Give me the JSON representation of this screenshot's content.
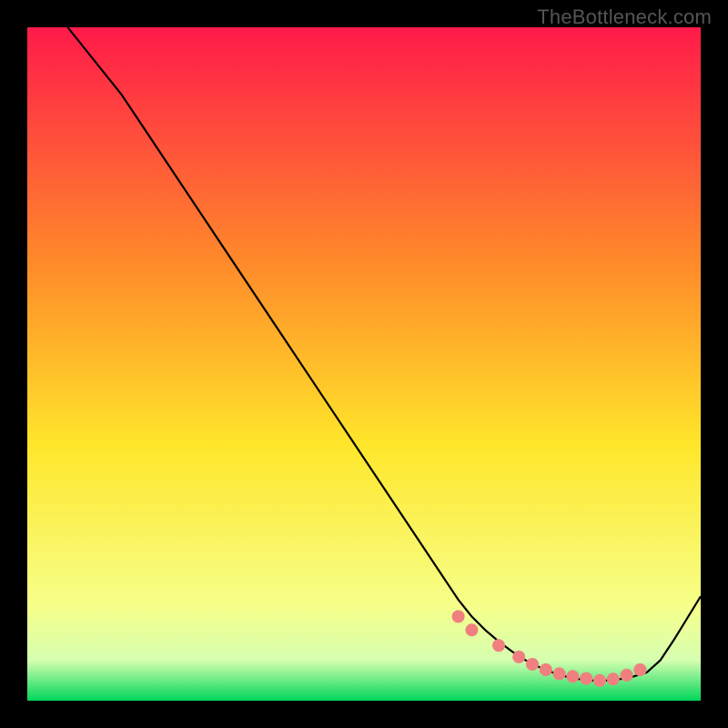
{
  "watermark": "TheBottleneck.com",
  "chart_data": {
    "type": "line",
    "title": "",
    "xlabel": "",
    "ylabel": "",
    "xlim": [
      0,
      100
    ],
    "ylim": [
      0,
      100
    ],
    "grid": false,
    "legend": false,
    "background_gradient": {
      "top": "#ff1a4a",
      "mid_upper": "#ff8a2a",
      "mid": "#ffe62a",
      "mid_lower": "#f6ff8a",
      "band": "#d6ffb0",
      "bottom": "#00d65a"
    },
    "series": [
      {
        "name": "bottleneck-curve",
        "color": "#000000",
        "x": [
          6,
          10,
          14,
          18,
          22,
          26,
          30,
          34,
          38,
          42,
          46,
          50,
          54,
          58,
          62,
          64,
          66,
          68,
          70,
          72,
          74,
          76,
          78,
          80,
          82,
          84,
          85,
          86,
          88,
          90,
          92,
          94,
          96,
          100
        ],
        "y": [
          100,
          95,
          90,
          84,
          78,
          72,
          66,
          60,
          54,
          48,
          42,
          36,
          30,
          24,
          18,
          15,
          12.5,
          10.5,
          8.8,
          7.3,
          6.0,
          5.0,
          4.2,
          3.6,
          3.2,
          3.0,
          3.0,
          3.0,
          3.2,
          3.6,
          4.2,
          6.0,
          9.0,
          15.5
        ]
      }
    ],
    "markers": {
      "name": "optimum-dots",
      "color": "#f08080",
      "radius_px": 7,
      "x": [
        64,
        66,
        70,
        73,
        75,
        77,
        79,
        81,
        83,
        85,
        87,
        89,
        91
      ],
      "y": [
        12.5,
        10.5,
        8.2,
        6.5,
        5.4,
        4.6,
        4.0,
        3.6,
        3.3,
        3.0,
        3.2,
        3.8,
        4.6
      ]
    }
  }
}
